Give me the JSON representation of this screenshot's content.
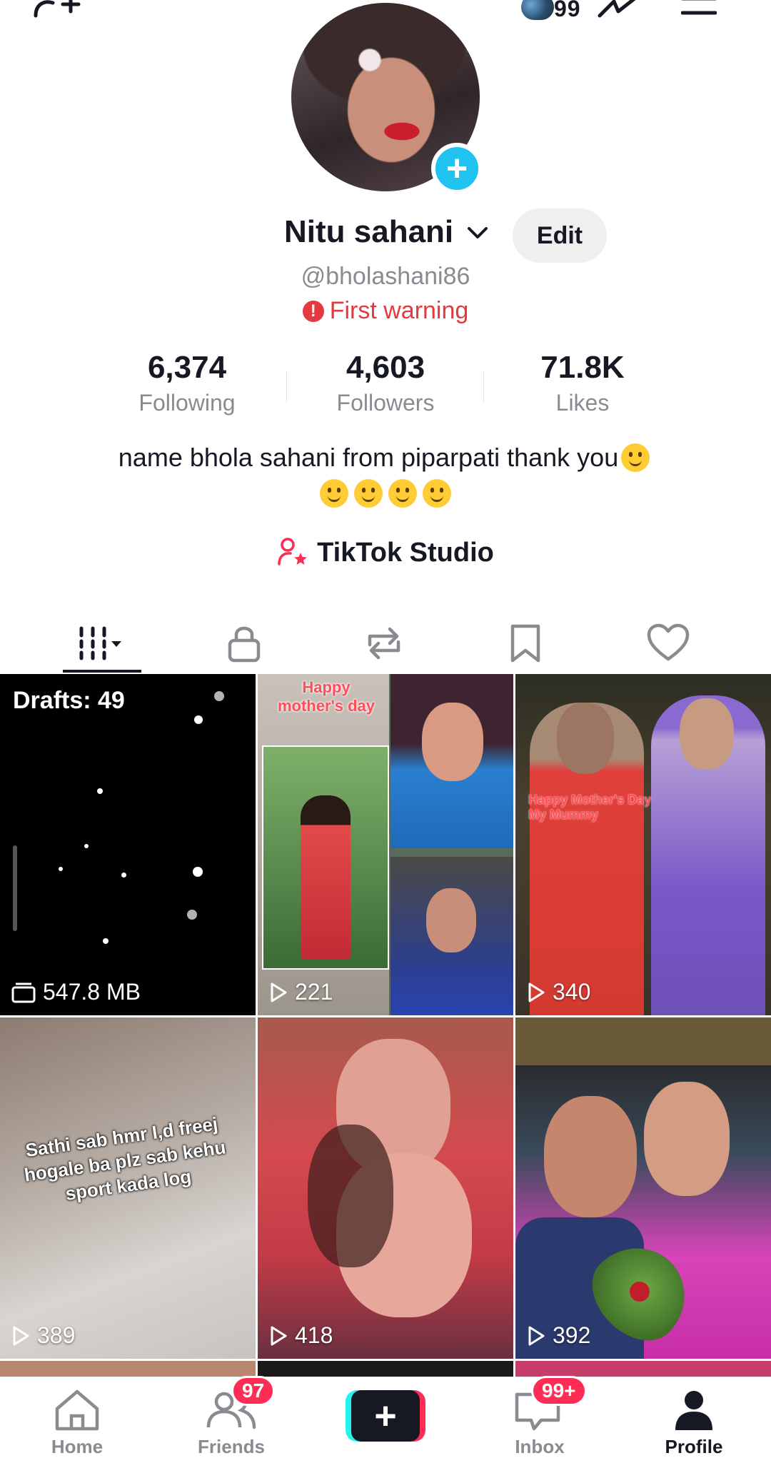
{
  "top": {
    "notification_count": "99"
  },
  "profile": {
    "name": "Nitu sahani",
    "edit_label": "Edit",
    "handle": "@bholashani86",
    "warning": "First warning",
    "stats": [
      {
        "value": "6,374",
        "label": "Following"
      },
      {
        "value": "4,603",
        "label": "Followers"
      },
      {
        "value": "71.8K",
        "label": "Likes"
      }
    ],
    "bio_line1": "name bhola sahani from piparpati thank you",
    "studio_label": "TikTok Studio"
  },
  "tabs": [
    "videos-grid",
    "private",
    "reposts",
    "favorites",
    "liked"
  ],
  "grid": {
    "drafts_label": "Drafts: 49",
    "drafts_size": "547.8 MB",
    "tiles": [
      {
        "views": "221",
        "overlay": "Happy mother's day"
      },
      {
        "views": "340",
        "overlay": "Happy Mother's Day My Mummy"
      },
      {
        "views": "389",
        "overlay": "Sathi sab hmr I,d freej hogale ba plz sab kehu sport kada log"
      },
      {
        "views": "418"
      },
      {
        "views": "392"
      }
    ]
  },
  "nav": {
    "home": "Home",
    "friends": "Friends",
    "friends_badge": "97",
    "inbox": "Inbox",
    "inbox_badge": "99+",
    "profile": "Profile"
  },
  "colors": {
    "accent": "#fe2c55",
    "cyan": "#25f4ee",
    "warning": "#e3393f",
    "plus_blue": "#20c2ef"
  }
}
